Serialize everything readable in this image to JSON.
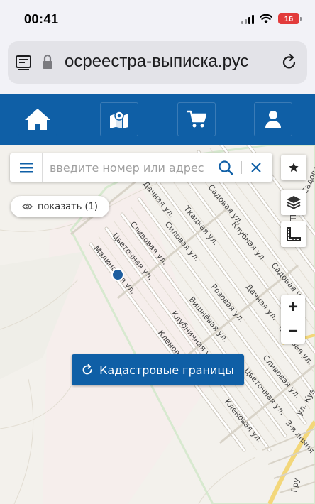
{
  "status_bar": {
    "time": "00:41",
    "battery": "16"
  },
  "browser": {
    "url": "осреестра-выписка.рус"
  },
  "search": {
    "placeholder": "введите номер или адрес"
  },
  "show_button": {
    "label": "показать (1)"
  },
  "cadastre_button": {
    "label": "Кадастровые границы"
  },
  "zoom": {
    "in_label": "+",
    "out_label": "−"
  },
  "streets": [
    {
      "name": "Дачная ул."
    },
    {
      "name": "Садовая ул."
    },
    {
      "name": "Ткацкая ул."
    },
    {
      "name": "Силовая ул."
    },
    {
      "name": "Сливовая ул."
    },
    {
      "name": "Клубная ул."
    },
    {
      "name": "Цветочная ул."
    },
    {
      "name": "Малиновая ул."
    },
    {
      "name": "Розовая ул."
    },
    {
      "name": "Вишнёвая ул."
    },
    {
      "name": "Садовая ул."
    },
    {
      "name": "Дачная ул."
    },
    {
      "name": "Клубничная ул."
    },
    {
      "name": "Кленовая ул."
    },
    {
      "name": "Силовая ул."
    },
    {
      "name": "Сливовая ул."
    },
    {
      "name": "Цветочная ул."
    },
    {
      "name": "Кленовая ул."
    },
    {
      "name": "3-я линия"
    },
    {
      "name": "ул. Куз"
    },
    {
      "name": "Шк"
    },
    {
      "name": "Садовая ул."
    },
    {
      "name": "Гру"
    }
  ],
  "colors": {
    "brand": "#0f5fa6",
    "location": "#1f5fa0"
  },
  "icons": {
    "nav": [
      "home-icon",
      "map-pin-icon",
      "cart-icon",
      "user-icon"
    ],
    "map_tools": [
      "star-icon",
      "layers-icon",
      "ruler-icon"
    ]
  }
}
